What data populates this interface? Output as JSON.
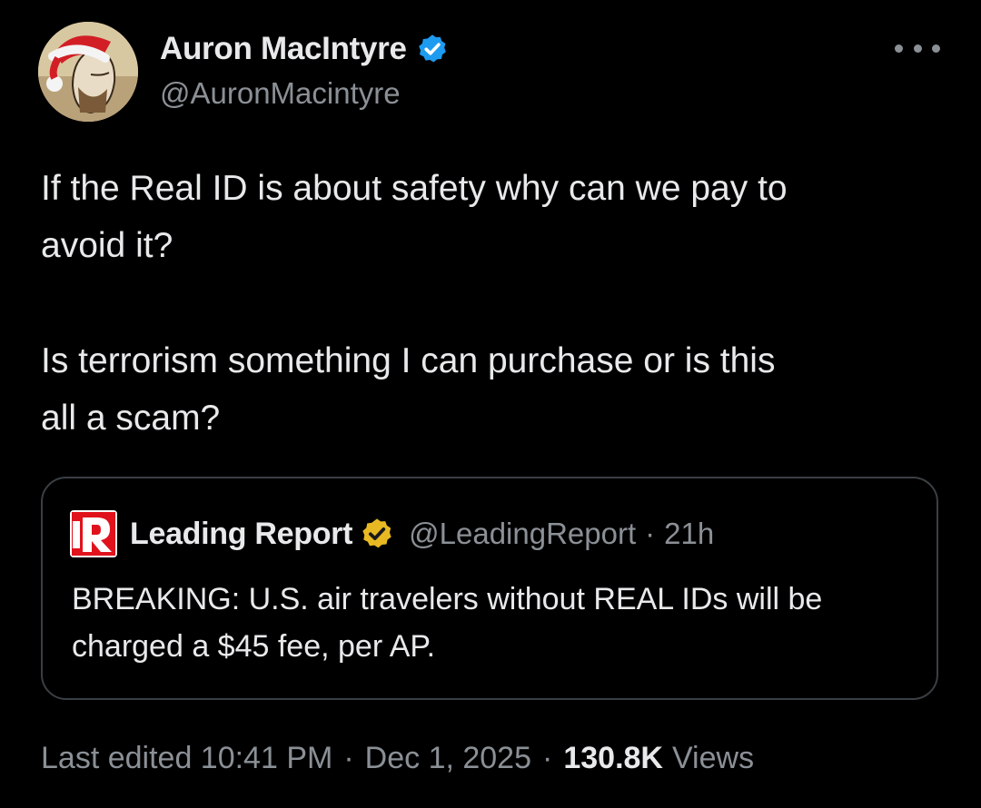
{
  "author": {
    "display_name": "Auron MacIntyre",
    "handle": "@AuronMacintyre",
    "avatar_icon": "avatar-santa-hat-portrait",
    "verified_icon": "blue-verified-badge-icon",
    "verified_color": "#1d9bf0"
  },
  "tweet": {
    "paragraph_1": "If the Real ID is about safety why can  we pay to\navoid it?",
    "paragraph_2": "Is terrorism something I can purchase or is this\nall a scam?"
  },
  "quote": {
    "logo_icon": "leading-report-logo",
    "logo_color": "#e0121c",
    "display_name": "Leading Report",
    "verified_icon": "gold-verified-badge-icon",
    "verified_color": "#e8b923",
    "handle": "@LeadingReport",
    "separator": "·",
    "time": "21h",
    "text": "BREAKING: U.S. air travelers without REAL IDs will be charged a $45 fee, per AP."
  },
  "meta": {
    "edited_label": "Last edited 10:41 PM",
    "separator": "·",
    "date": "Dec 1, 2025",
    "views_count": "130.8K",
    "views_label": "Views"
  },
  "more_icon": "more-horizontal-icon"
}
